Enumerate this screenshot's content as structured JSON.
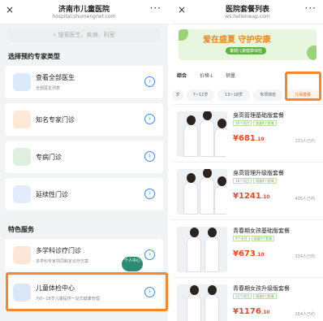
{
  "left": {
    "title": "济南市儿童医院",
    "url": "hospital.shumengnet.com",
    "close": "×",
    "more": "···",
    "search_placeholder": "搜索医生、疾病、科室",
    "section1": "选择预约专家类型",
    "cards": [
      {
        "name": "查看全部医生",
        "sub": "全部医生列表"
      },
      {
        "name": "知名专家门诊",
        "sub": ""
      },
      {
        "name": "专病门诊",
        "sub": ""
      },
      {
        "name": "延续性门诊",
        "sub": ""
      }
    ],
    "section2": "特色服务",
    "services": [
      {
        "name": "多学科诊疗门诊",
        "sub": "多学科专家共同制定诊疗方案"
      },
      {
        "name": "儿童体检中心",
        "sub": "为0~18岁儿童提供一站式健康管理"
      }
    ]
  },
  "right": {
    "title": "医院套餐列表",
    "url": "ws.hellenwap.com",
    "close": "×",
    "more": "···",
    "banner": {
      "text": "爱在盛夏 守护安康",
      "sub": "暑期儿童健康体检"
    },
    "tabs": [
      "综合",
      "价格↓",
      "销量"
    ],
    "filters": [
      "岁",
      "7~12岁",
      "13~18岁",
      "专项体检",
      "儿保套餐"
    ],
    "packages": [
      {
        "title": "身高管理基础版套餐",
        "tags": [
          "16个项目",
          "限量4个套餐"
        ],
        "price": "681",
        "cents": ".10",
        "sold": "333人已约"
      },
      {
        "title": "身高管理升级版套餐",
        "tags": [
          "18个项目",
          "限量4个套餐"
        ],
        "price": "1241",
        "cents": ".10",
        "sold": "405人已约"
      },
      {
        "title": "青春期女孩基础版套餐",
        "tags": [
          "9个项目",
          "限量9个套餐"
        ],
        "price": "673",
        "cents": ".10",
        "sold": "334人已约"
      },
      {
        "title": "青春期女孩升级版套餐",
        "tags": [
          "12个项目",
          "限量4个套餐"
        ],
        "price": "1176",
        "cents": ".10",
        "sold": "264人已约"
      }
    ],
    "fab": "个人中心"
  }
}
